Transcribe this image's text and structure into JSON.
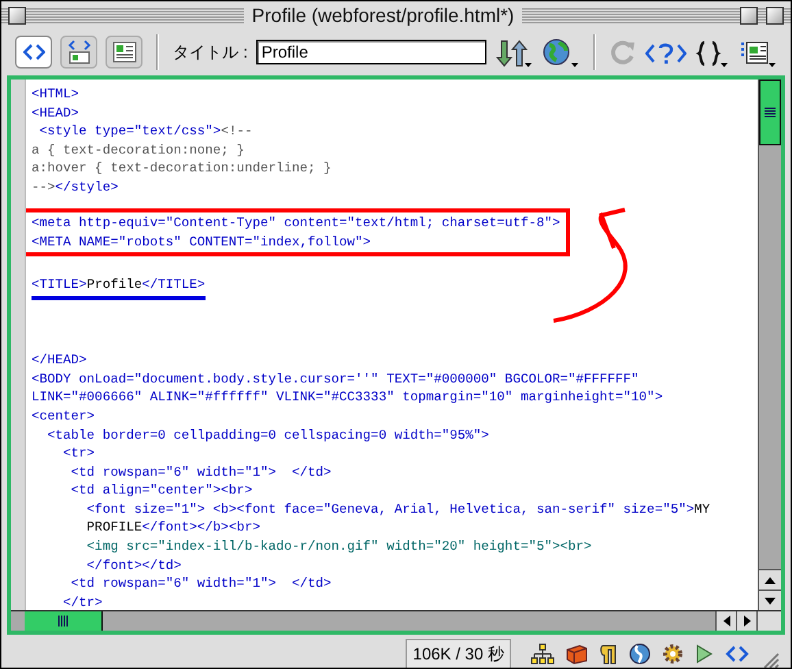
{
  "window": {
    "title": "Profile (webforest/profile.html*)"
  },
  "toolbar": {
    "view_buttons": [
      {
        "selected": true
      },
      {
        "selected": false
      },
      {
        "selected": false
      }
    ],
    "title_label": "タイトル :",
    "title_value": "Profile",
    "refresh_button": {
      "disabled": true
    }
  },
  "code": {
    "blocks": [
      {
        "kind": "plain",
        "lines": [
          {
            "kind": "code",
            "segments": [
              {
                "kind": "tag",
                "text": "<HTML>"
              }
            ]
          },
          {
            "kind": "code",
            "segments": [
              {
                "kind": "tag",
                "text": "<HEAD>"
              }
            ]
          },
          {
            "kind": "code",
            "segments": [
              {
                "kind": "tag",
                "text": " <style type=\"text/css\">"
              },
              {
                "kind": "css",
                "text": "<!--"
              }
            ]
          },
          {
            "kind": "code",
            "segments": [
              {
                "kind": "css",
                "text": "a { text-decoration:none; }"
              }
            ]
          },
          {
            "kind": "code",
            "segments": [
              {
                "kind": "css",
                "text": "a:hover { text-decoration:underline; }"
              }
            ]
          },
          {
            "kind": "code",
            "segments": [
              {
                "kind": "css",
                "text": "-->"
              },
              {
                "kind": "tag",
                "text": "</style>"
              }
            ]
          },
          {
            "kind": "blank"
          }
        ]
      },
      {
        "kind": "boxed",
        "lines": [
          {
            "kind": "code",
            "segments": [
              {
                "kind": "tag",
                "text": "<meta http-equiv=\"Content-Type\" content=\"text/html; charset=utf-8\">"
              }
            ]
          },
          {
            "kind": "code",
            "segments": [
              {
                "kind": "tag",
                "text": "<META NAME=\"robots\" CONTENT=\"index,follow\">"
              }
            ]
          }
        ]
      },
      {
        "kind": "plain",
        "lines": [
          {
            "kind": "blank"
          }
        ]
      },
      {
        "kind": "underlined",
        "lines": [
          {
            "kind": "code",
            "segments": [
              {
                "kind": "tag",
                "text": "<TITLE>"
              },
              {
                "kind": "text",
                "text": "Profile"
              },
              {
                "kind": "tag",
                "text": "</TITLE>"
              }
            ]
          }
        ]
      },
      {
        "kind": "plain",
        "lines": [
          {
            "kind": "blank"
          },
          {
            "kind": "blank"
          },
          {
            "kind": "blank"
          },
          {
            "kind": "code",
            "segments": [
              {
                "kind": "tag",
                "text": "</HEAD>"
              }
            ]
          },
          {
            "kind": "code",
            "segments": [
              {
                "kind": "tag",
                "text": "<BODY onLoad=\"document.body.style.cursor=''\" TEXT=\"#000000\" BGCOLOR=\"#FFFFFF\""
              }
            ]
          },
          {
            "kind": "code",
            "segments": [
              {
                "kind": "tag",
                "text": "LINK=\"#006666\" ALINK=\"#ffffff\" VLINK=\"#CC3333\" topmargin=\"10\" marginheight=\"10\">"
              }
            ]
          },
          {
            "kind": "code",
            "segments": [
              {
                "kind": "tag",
                "text": "<center>"
              }
            ]
          },
          {
            "kind": "code",
            "segments": [
              {
                "kind": "tag",
                "text": "  <table border=0 cellpadding=0 cellspacing=0 width=\"95%\">"
              }
            ]
          },
          {
            "kind": "code",
            "segments": [
              {
                "kind": "tag",
                "text": "    <tr>"
              }
            ]
          },
          {
            "kind": "code",
            "segments": [
              {
                "kind": "tag",
                "text": "     <td rowspan=\"6\" width=\"1\">  </td>"
              }
            ]
          },
          {
            "kind": "code",
            "segments": [
              {
                "kind": "tag",
                "text": "     <td align=\"center\"><br>"
              }
            ]
          },
          {
            "kind": "code",
            "segments": [
              {
                "kind": "tag",
                "text": "       <font size=\"1\"> <b><font face=\"Geneva, Arial, Helvetica, san-serif\" size=\"5\">"
              },
              {
                "kind": "text",
                "text": "MY"
              }
            ]
          },
          {
            "kind": "code",
            "segments": [
              {
                "kind": "text",
                "text": "       PROFILE"
              },
              {
                "kind": "tag",
                "text": "</font></b><br>"
              }
            ]
          },
          {
            "kind": "code",
            "segments": [
              {
                "kind": "img",
                "text": "       <img src=\"index-ill/b-kado-r/non.gif\" width=\"20\" height=\"5\"><br>"
              }
            ]
          },
          {
            "kind": "code",
            "segments": [
              {
                "kind": "tag",
                "text": "       </font></td>"
              }
            ]
          },
          {
            "kind": "code",
            "segments": [
              {
                "kind": "tag",
                "text": "     <td rowspan=\"6\" width=\"1\">  </td>"
              }
            ]
          },
          {
            "kind": "code",
            "segments": [
              {
                "kind": "tag",
                "text": "    </tr>"
              }
            ]
          }
        ]
      }
    ]
  },
  "status_bar": {
    "size": "106K / 30 秒"
  }
}
